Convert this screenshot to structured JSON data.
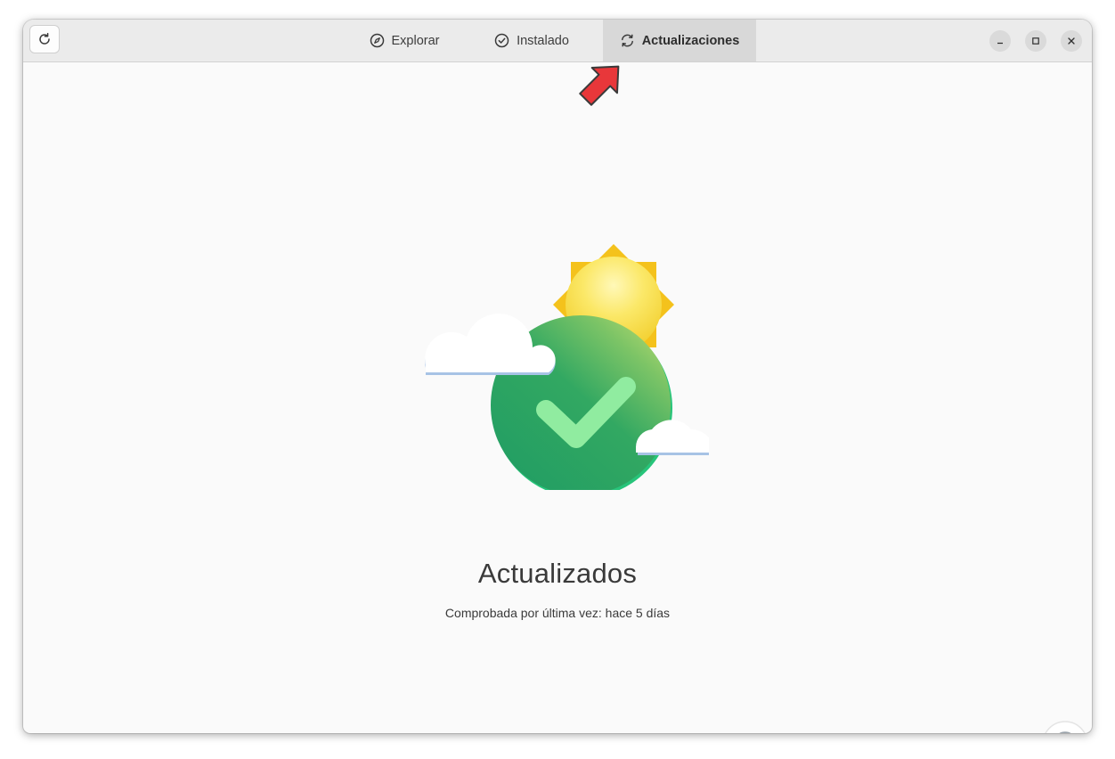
{
  "headerbar": {
    "refresh_icon": "refresh-icon",
    "tabs": [
      {
        "label": "Explorar",
        "icon": "compass-icon",
        "active": false
      },
      {
        "label": "Instalado",
        "icon": "check-circle-icon",
        "active": false
      },
      {
        "label": "Actualizaciones",
        "icon": "sync-icon",
        "active": true
      }
    ],
    "window_controls": [
      "minimize-icon",
      "maximize-icon",
      "close-icon"
    ]
  },
  "main": {
    "illustration": "up-to-date-illustration",
    "title": "Actualizados",
    "subtitle": "Comprobada por última vez: hace 5 días"
  },
  "colors": {
    "header_bg": "#ebebeb",
    "active_tab_bg": "#d8d8d8",
    "content_bg": "#fafafa",
    "check_green": "#2aa569",
    "sun_yellow": "#f5c518",
    "arrow_red": "#e8373a"
  }
}
